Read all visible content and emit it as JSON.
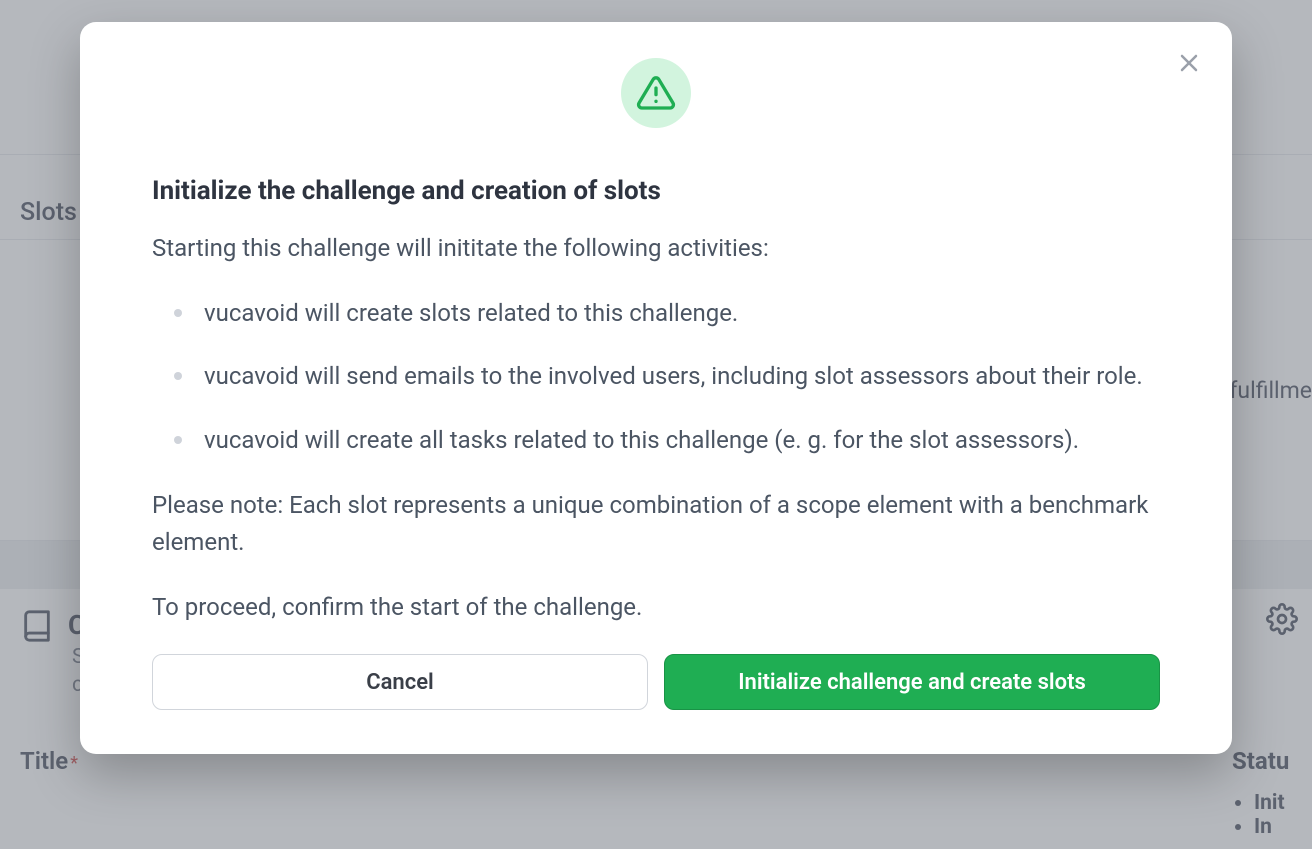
{
  "background": {
    "tab_slots": "Slots",
    "right_truncated_text": "al fulfillme",
    "section_letter": "C",
    "section_sub_first_letter": "S",
    "section_sub_second_letter": "c",
    "title_label": "Title",
    "status_label": "Statu",
    "status_items": [
      "Init",
      "In"
    ]
  },
  "modal": {
    "heading": "Initialize the challenge and creation of slots",
    "intro": "Starting this challenge will inititate the following activities:",
    "bullets": [
      "vucavoid will create slots related to this challenge.",
      "vucavoid will send emails to the involved users, including slot assessors about their role.",
      "vucavoid will create all tasks related to this challenge (e. g. for the slot assessors)."
    ],
    "note": "Please note: Each slot represents a unique combination of a scope element with a benchmark element.",
    "confirm_text": "To proceed, confirm the start of the challenge.",
    "cancel_label": "Cancel",
    "primary_label": "Initialize challenge and create slots"
  },
  "icons": {
    "warning": "warning-triangle-icon",
    "close": "close-icon",
    "gear": "gear-icon",
    "book": "book-icon"
  },
  "colors": {
    "accent_green": "#1fae53",
    "accent_green_bg": "#d2f4de",
    "text_primary": "#2e3440",
    "text_body": "#4b5563",
    "border": "#d1d5db"
  }
}
